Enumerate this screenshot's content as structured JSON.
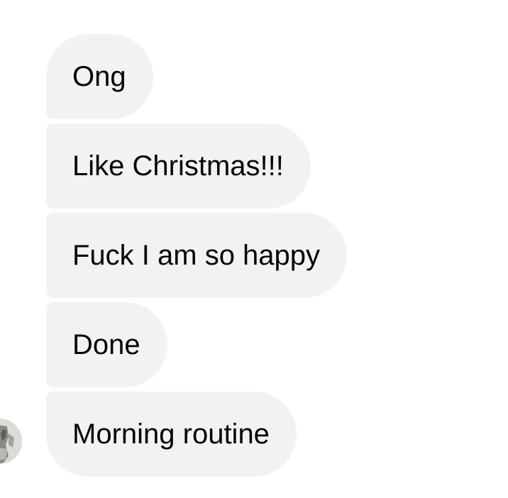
{
  "messages": [
    {
      "text": "Ong"
    },
    {
      "text": "Like Christmas!!!"
    },
    {
      "text": "Fuck I am so happy"
    },
    {
      "text": "Done"
    },
    {
      "text": "Morning routine"
    }
  ],
  "avatar": {
    "icon": "profile-photo"
  },
  "colors": {
    "bubble_background": "#f1f2f4",
    "text": "#050505",
    "page_background": "#ffffff"
  }
}
